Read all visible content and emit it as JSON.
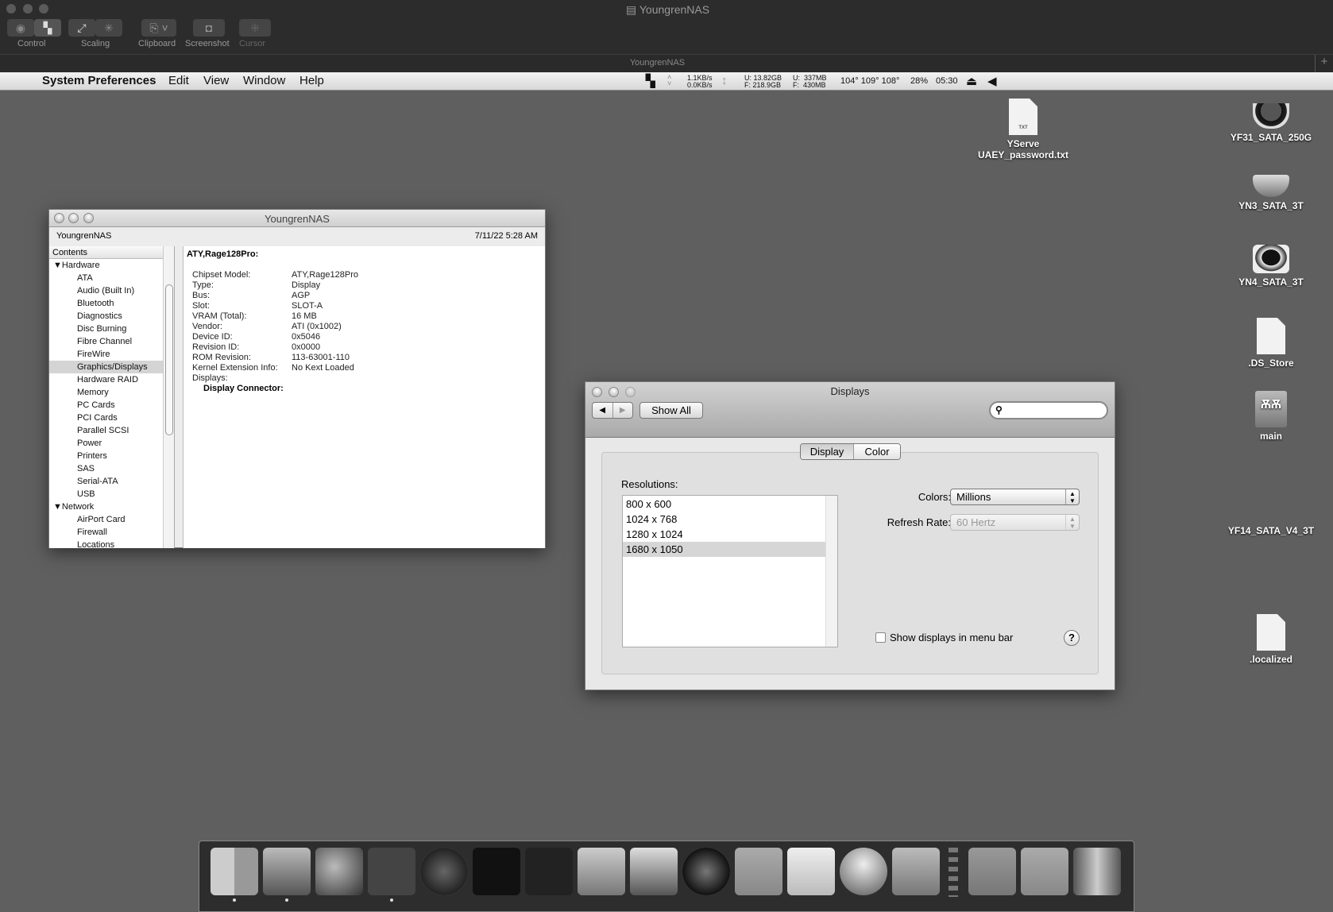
{
  "viewer": {
    "title": "YoungrenNAS",
    "subtitle": "YoungrenNAS",
    "toolbar": [
      {
        "label": "Control"
      },
      {
        "label": "Scaling"
      },
      {
        "label": "Clipboard"
      },
      {
        "label": "Screenshot"
      },
      {
        "label": "Cursor"
      }
    ]
  },
  "menubar": {
    "app": "System Preferences",
    "items": [
      "Edit",
      "View",
      "Window",
      "Help"
    ],
    "status": {
      "net_up": "1.1KB/s",
      "net_down": "0.0KB/s",
      "disk_u": "U: 13.82GB",
      "disk_f": "F: 218.9GB",
      "mem_u": "U:",
      "mem_u_val": "337MB",
      "mem_f": "F:",
      "mem_f_val": "430MB",
      "temps": "104° 109° 108°",
      "cpu": "28%",
      "clock": "05:30"
    }
  },
  "profiler": {
    "title": "YoungrenNAS",
    "computer": "YoungrenNAS",
    "date": "7/11/22 5:28 AM",
    "contents_header": "Contents",
    "tree": [
      {
        "label": "Hardware",
        "group": true
      },
      {
        "label": "ATA"
      },
      {
        "label": "Audio (Built In)"
      },
      {
        "label": "Bluetooth"
      },
      {
        "label": "Diagnostics"
      },
      {
        "label": "Disc Burning"
      },
      {
        "label": "Fibre Channel"
      },
      {
        "label": "FireWire"
      },
      {
        "label": "Graphics/Displays",
        "selected": true
      },
      {
        "label": "Hardware RAID"
      },
      {
        "label": "Memory"
      },
      {
        "label": "PC Cards"
      },
      {
        "label": "PCI Cards"
      },
      {
        "label": "Parallel SCSI"
      },
      {
        "label": "Power"
      },
      {
        "label": "Printers"
      },
      {
        "label": "SAS"
      },
      {
        "label": "Serial-ATA"
      },
      {
        "label": "USB"
      },
      {
        "label": "Network",
        "group": true
      },
      {
        "label": "AirPort Card"
      },
      {
        "label": "Firewall"
      },
      {
        "label": "Locations"
      }
    ],
    "detail_title": "ATY,Rage128Pro:",
    "details": [
      [
        "Chipset Model:",
        "ATY,Rage128Pro"
      ],
      [
        "Type:",
        "Display"
      ],
      [
        "Bus:",
        "AGP"
      ],
      [
        "Slot:",
        "SLOT-A"
      ],
      [
        "VRAM (Total):",
        "16 MB"
      ],
      [
        "Vendor:",
        "ATI (0x1002)"
      ],
      [
        "Device ID:",
        "0x5046"
      ],
      [
        "Revision ID:",
        "0x0000"
      ],
      [
        "ROM Revision:",
        "113-63001-110"
      ],
      [
        "Kernel Extension Info:",
        "No Kext Loaded"
      ],
      [
        "Displays:",
        ""
      ]
    ],
    "display_connector": "Display Connector:"
  },
  "displays": {
    "title": "Displays",
    "show_all": "Show All",
    "search_placeholder": "",
    "tabs": [
      "Display",
      "Color"
    ],
    "active_tab": "Display",
    "resolutions_label": "Resolutions:",
    "resolutions": [
      "800 x 600",
      "1024 x 768",
      "1280 x 1024",
      "1680 x 1050"
    ],
    "selected_resolution": "1680 x 1050",
    "colors_label": "Colors:",
    "colors_value": "Millions",
    "refresh_label": "Refresh Rate:",
    "refresh_value": "60 Hertz",
    "show_in_menu": "Show displays in menu bar",
    "show_in_menu_checked": false,
    "help": "?"
  },
  "desktop": {
    "icons": [
      {
        "label1": "YServe",
        "label2": "UAEY_password.txt",
        "badge": "TXT"
      },
      {
        "label": "YF31_SATA_250G"
      },
      {
        "label": "YN3_SATA_3T"
      },
      {
        "label": "YN4_SATA_3T"
      },
      {
        "label": ".DS_Store"
      },
      {
        "label": "main"
      },
      {
        "label": "YF14_SATA_V4_3T"
      },
      {
        "label": ".localized"
      }
    ]
  },
  "dock": [
    "finder",
    "system-preferences",
    "network-utility",
    "system-profiler",
    "radar",
    "terminal",
    "activity-monitor",
    "disk-utility",
    "ccleaner",
    "mac-os-x",
    "archive-utility",
    "textedit",
    "globe",
    "console",
    "folder",
    "downloads-folder",
    "trash"
  ]
}
